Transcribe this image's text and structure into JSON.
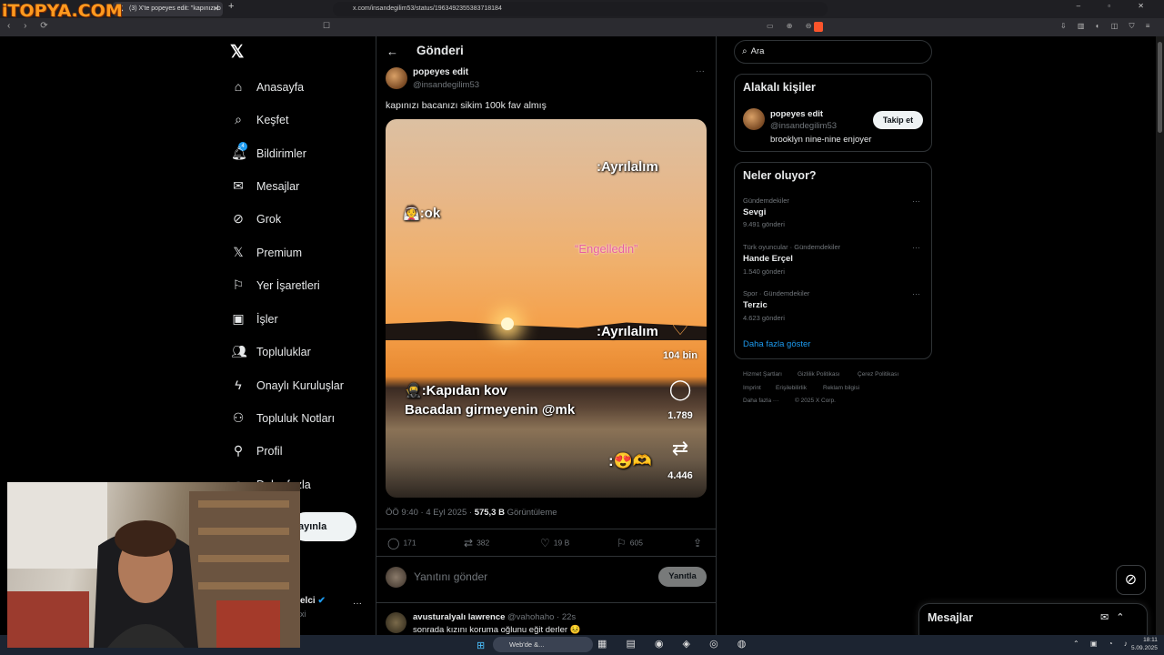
{
  "browser": {
    "watermark": "iTOPYA.COM",
    "tab_title": "(3) X'te popeyes edit: \"kapınızı b",
    "new_tab": "+",
    "url": "x.com/insandegilim53/status/1963492355383718184"
  },
  "nav": {
    "items": [
      {
        "label": "Anasayfa",
        "icon": "home-icon"
      },
      {
        "label": "Keşfet",
        "icon": "search-icon"
      },
      {
        "label": "Bildirimler",
        "icon": "bell-icon"
      },
      {
        "label": "Mesajlar",
        "icon": "mail-icon"
      },
      {
        "label": "Grok",
        "icon": "grok-icon"
      },
      {
        "label": "Premium",
        "icon": "x-logo-icon"
      },
      {
        "label": "Yer İşaretleri",
        "icon": "bookmark-icon"
      },
      {
        "label": "İşler",
        "icon": "briefcase-icon"
      },
      {
        "label": "Topluluklar",
        "icon": "people-icon"
      },
      {
        "label": "Onaylı Kuruluşlar",
        "icon": "lightning-icon"
      },
      {
        "label": "Topluluk Notları",
        "icon": "community-notes-icon"
      },
      {
        "label": "Profil",
        "icon": "person-icon"
      },
      {
        "label": "Daha fazla",
        "icon": "more-circle-icon"
      }
    ],
    "notification_count": "4",
    "post_button": "ayınla",
    "account_name": "elci",
    "account_handle": "xi"
  },
  "post": {
    "header_title": "Gönderi",
    "author_name": "popeyes edit",
    "author_handle": "@insandegilim53",
    "text": "kapınızı bacanızı sikim 100k fav almış",
    "video": {
      "caption_top": ":Ayrılalım",
      "caption_ok": ":ok",
      "caption_pink": "“Engelledin”",
      "caption_mid": ":Ayrılalım",
      "caption_bottom1": ":Kapıdan kov",
      "caption_bottom2": "Bacadan girmeyenin @mk",
      "likes": "104 bin",
      "comments": "1.789",
      "reposts": "4.446"
    },
    "time": "ÖÖ 9:40 · 4 Eyl 2025 · ",
    "views": "575,3 B",
    "views_label": "Görüntüleme",
    "stats": {
      "replies": "171",
      "reposts": "382",
      "likes": "19 B",
      "bookmarks": "605"
    },
    "reply_placeholder": "Yanıtını gönder",
    "reply_button": "Yanıtla"
  },
  "comment": {
    "name": "avusturalyalı lawrence",
    "handle": "@vahohaho · 22s",
    "text": "sonrada kızını koruma oğlunu eğit derler 😣"
  },
  "right": {
    "search_placeholder": "Ara",
    "relevant_title": "Alakalı kişiler",
    "relevant": {
      "name": "popeyes edit",
      "handle": "@insandegilim53",
      "bio": "brooklyn nine-nine enjoyer",
      "follow": "Takip et"
    },
    "trends_title": "Neler oluyor?",
    "trends": [
      {
        "context": "Gündemdekiler",
        "name": "Sevgi",
        "count": "9.491 gönderi"
      },
      {
        "context": "Türk oyuncular · Gündemdekiler",
        "name": "Hande Erçel",
        "count": "1.540 gönderi"
      },
      {
        "context": "Spor · Gündemdekiler",
        "name": "Terzic",
        "count": "4.623 gönderi"
      }
    ],
    "show_more": "Daha fazla göster",
    "footer": [
      "Hizmet Şartları",
      "Gizlilik Politikası",
      "Çerez Politikası",
      "Imprint",
      "Erişilebilirlik",
      "Reklam bilgisi",
      "Daha fazla ···",
      "© 2025 X Corp."
    ]
  },
  "messages": {
    "title": "Mesajlar"
  },
  "taskbar": {
    "search": "Web'de &...",
    "time": "18:11",
    "date": "5.09.2025"
  }
}
